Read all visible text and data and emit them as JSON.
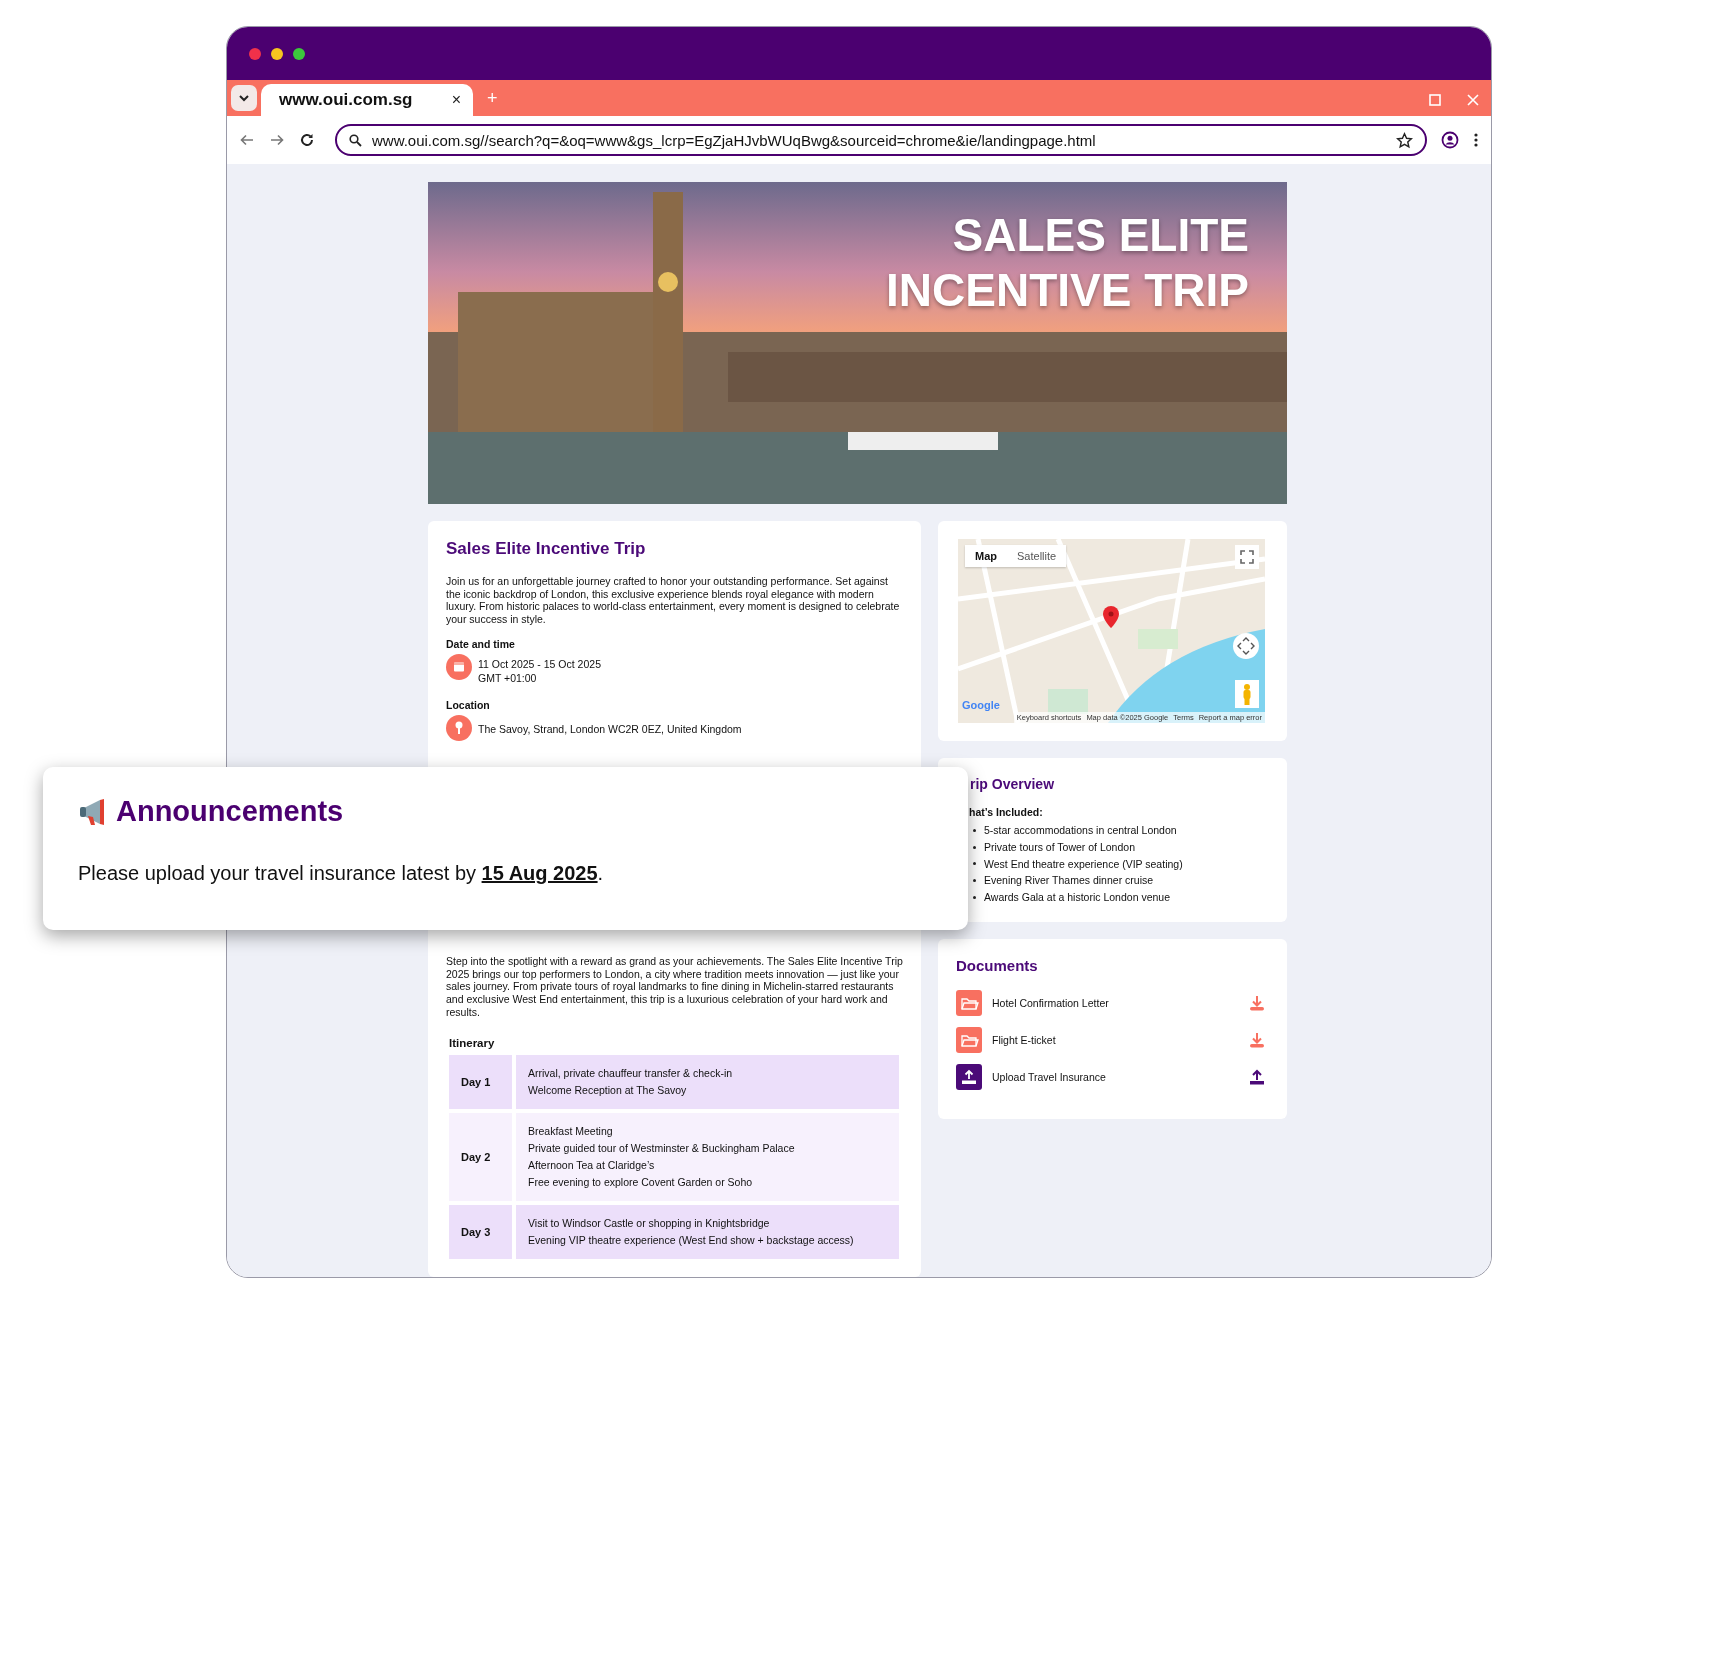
{
  "browser": {
    "tab": {
      "title": "www.oui.com.sg",
      "close": "×"
    },
    "new_tab": "+",
    "url": "www.oui.com.sg//search?q=&oq=www&gs_lcrp=EgZjaHJvbWUqBwg&sourceid=chrome&ie/landingpage.html"
  },
  "hero": {
    "title_lines": [
      "SALES ELITE",
      "INCENTIVE TRIP"
    ]
  },
  "event": {
    "title": "Sales Elite Incentive Trip",
    "description": "Join us for an unforgettable journey crafted to honor your outstanding performance. Set against the iconic backdrop of London, this exclusive experience blends royal elegance with modern luxury. From historic palaces to world-class entertainment, every moment is designed to celebrate your success in style.",
    "date_label": "Date and time",
    "date_lines": [
      "11 Oct 2025 - 15 Oct 2025",
      "GMT +01:00"
    ],
    "location_label": "Location",
    "location": "The Savoy, Strand, London WC2R 0EZ, United Kingdom"
  },
  "rewards": {
    "description": "Step into the spotlight with a reward as grand as your achievements. The Sales Elite Incentive Trip 2025 brings our top performers to London, a city where tradition meets innovation — just like your sales journey. From private tours of royal landmarks to fine dining in Michelin-starred restaurants and exclusive West End entertainment, this trip is a luxurious celebration of your hard work and results.",
    "itinerary_label": "Itinerary",
    "days": [
      {
        "day": "Day 1",
        "items": [
          "Arrival, private chauffeur transfer & check-in",
          "Welcome Reception at The Savoy"
        ]
      },
      {
        "day": "Day 2",
        "items": [
          "Breakfast Meeting",
          "Private guided tour of Westminster & Buckingham Palace",
          "Afternoon Tea at Claridge’s",
          "Free evening to explore Covent Garden or Soho"
        ]
      },
      {
        "day": "Day 3",
        "items": [
          "Visit to Windsor Castle or shopping in Knightsbridge",
          "Evening VIP theatre experience (West End show + backstage access)"
        ]
      }
    ]
  },
  "map": {
    "types": [
      {
        "label": "Map",
        "selected": true
      },
      {
        "label": "Satellite",
        "selected": false
      }
    ],
    "logo": "Google",
    "footer": [
      "Keyboard shortcuts",
      "Map data ©2025 Google",
      "Terms",
      "Report a map error"
    ]
  },
  "overview": {
    "title": "rip Overview",
    "subtitle": "hat’s Included:",
    "items": [
      "5-star accommodations in central London",
      "Private tours of Tower of London",
      "West End theatre experience (VIP seating)",
      "Evening River Thames dinner cruise",
      "Awards Gala at a historic London venue"
    ]
  },
  "documents": {
    "title": "Documents",
    "items": [
      {
        "kind": "download",
        "label": "Hotel Confirmation Letter"
      },
      {
        "kind": "download",
        "label": "Flight E-ticket"
      },
      {
        "kind": "upload",
        "label": "Upload Travel Insurance"
      }
    ]
  },
  "announcement": {
    "title": "Announcements",
    "message": "Please upload your travel insurance latest by **15 Aug 2025**."
  }
}
